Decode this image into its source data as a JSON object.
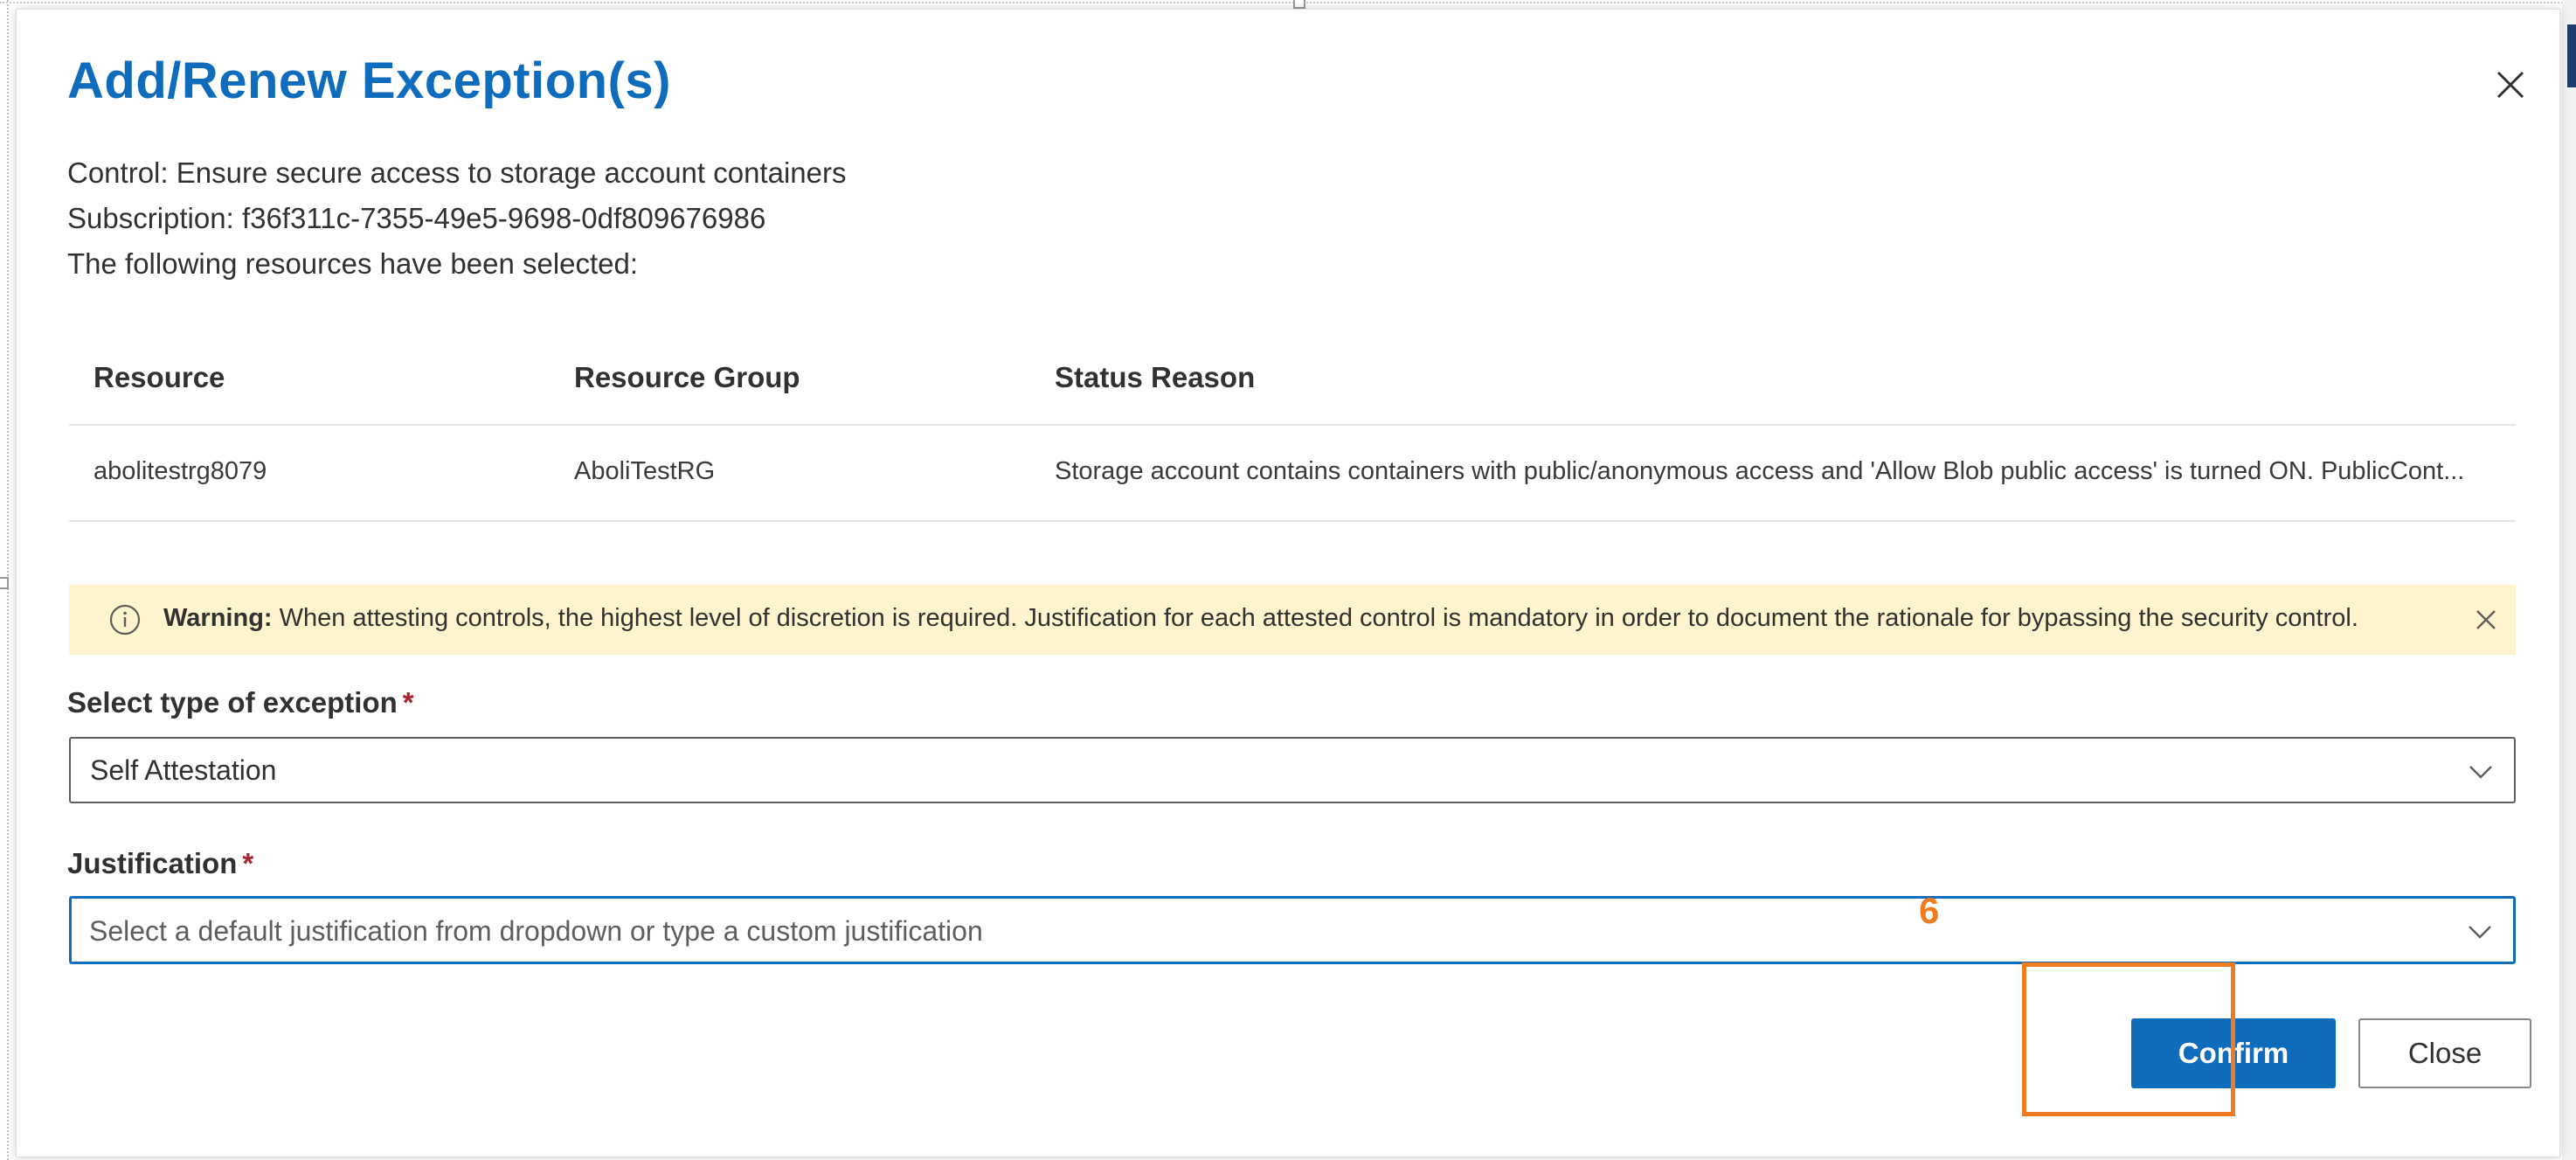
{
  "dialog": {
    "title": "Add/Renew Exception(s)",
    "control_label": "Control:",
    "control_value": "Ensure secure access to storage account containers",
    "subscription_label": "Subscription:",
    "subscription_value": "f36f311c-7355-49e5-9698-0df809676986",
    "selected_text": "The following resources have been selected:"
  },
  "table": {
    "headers": [
      "Resource",
      "Resource Group",
      "Status Reason"
    ],
    "rows": [
      [
        "abolitestrg8079",
        "AboliTestRG",
        "Storage account contains containers with public/anonymous access and 'Allow Blob public access' is turned ON. PublicCont..."
      ]
    ]
  },
  "warning": {
    "title": "Warning:",
    "message": "When attesting controls, the highest level of discretion is required. Justification for each attested control is mandatory in order to document the rationale for bypassing the security control."
  },
  "exception_type": {
    "label": "Select type of exception",
    "required_mark": "*",
    "value": "Self Attestation"
  },
  "justification": {
    "label": "Justification",
    "required_mark": "*",
    "placeholder": "Select a default justification from dropdown or type a custom justification",
    "value": ""
  },
  "annotation": {
    "step_number": "6",
    "color": "#f07c22"
  },
  "buttons": {
    "confirm": "Confirm",
    "close": "Close"
  },
  "colors": {
    "accent": "#0f6cbd",
    "warning_bg": "#fff4ce",
    "required": "#a4262c"
  },
  "icons": {
    "dialog_close": "close-icon",
    "warning": "info-icon",
    "warning_dismiss": "dismiss-icon",
    "dropdown": "chevron-down-icon"
  }
}
